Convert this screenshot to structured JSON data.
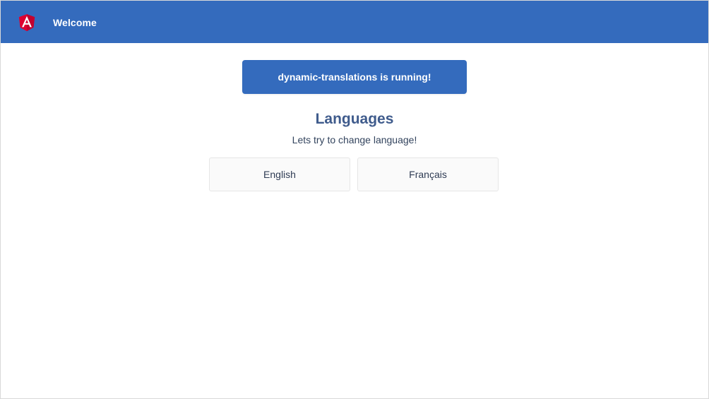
{
  "toolbar": {
    "title": "Welcome",
    "logo_icon": "angular-logo-icon",
    "color": "#346bbd"
  },
  "status_card": {
    "text": "dynamic-translations is running!"
  },
  "languages": {
    "title": "Languages",
    "subtitle": "Lets try to change language!",
    "options": [
      {
        "label": "English"
      },
      {
        "label": "Français"
      }
    ]
  },
  "colors": {
    "accent": "#346bbd",
    "logo_red": "#dd0031",
    "logo_dark_red": "#c3002f"
  }
}
